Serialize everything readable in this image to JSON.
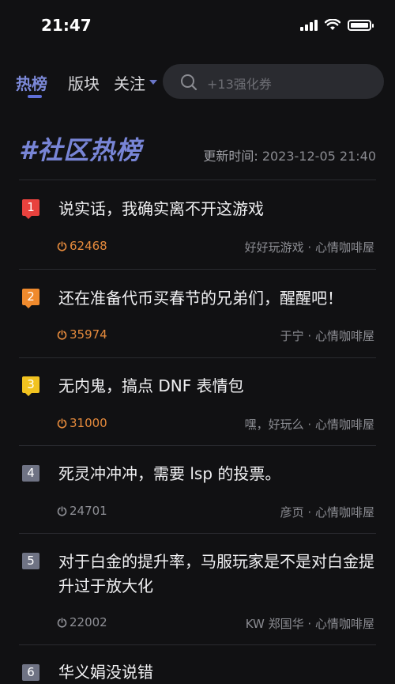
{
  "status": {
    "time": "21:47"
  },
  "tabs": [
    {
      "label": "热榜"
    },
    {
      "label": "版块"
    },
    {
      "label": "关注"
    }
  ],
  "search": {
    "placeholder": "+13强化券"
  },
  "header": {
    "title": "#社区热榜",
    "update_label": "更新时间:",
    "update_value": "2023-12-05 21:40"
  },
  "items": [
    {
      "rank": "1",
      "title": "说实话，我确实离不开这游戏",
      "heat": "62468",
      "author": "好好玩游戏",
      "sep": "·",
      "board": "心情咖啡屋"
    },
    {
      "rank": "2",
      "title": "还在准备代币买春节的兄弟们，醒醒吧！",
      "heat": "35974",
      "author": "于宁",
      "sep": "·",
      "board": "心情咖啡屋"
    },
    {
      "rank": "3",
      "title": "无内鬼，搞点 DNF 表情包",
      "heat": "31000",
      "author": "嘿，好玩么",
      "sep": "·",
      "board": "心情咖啡屋"
    },
    {
      "rank": "4",
      "title": "死灵冲冲冲，需要 lsp 的投票。",
      "heat": "24701",
      "author": "彦页",
      "sep": "·",
      "board": "心情咖啡屋"
    },
    {
      "rank": "5",
      "title": "对于白金的提升率，马服玩家是不是对白金提升过于放大化",
      "heat": "22002",
      "author": "KW 郑国华",
      "sep": "·",
      "board": "心情咖啡屋"
    },
    {
      "rank": "6",
      "title": "华义娟没说错"
    }
  ],
  "colors": {
    "accent": "#7885d6",
    "rank1": "#e8423e",
    "rank2": "#ef8a2d",
    "rank3": "#f2c320",
    "rank_default": "#6f7384",
    "heat_hot": "#e58a3c"
  }
}
